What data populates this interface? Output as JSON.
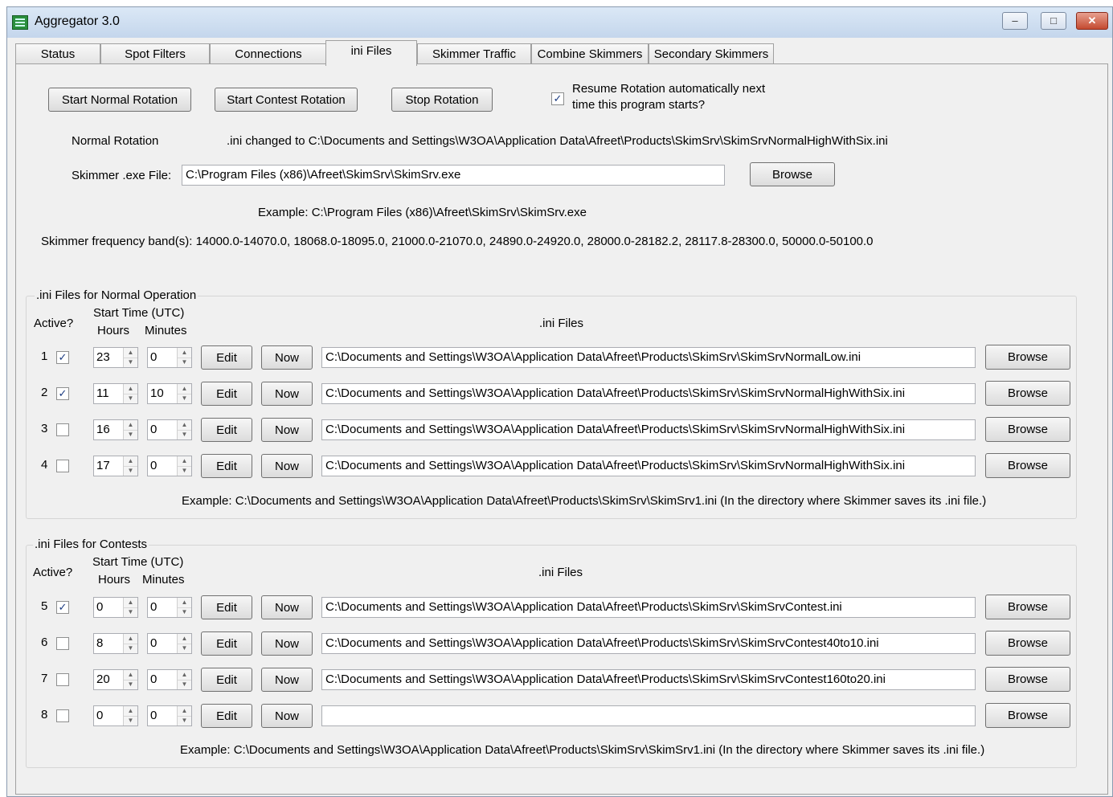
{
  "window": {
    "title": "Aggregator 3.0"
  },
  "tabs": [
    "Status",
    "Spot Filters",
    "Connections",
    "ini Files",
    "Skimmer Traffic",
    "Combine Skimmers",
    "Secondary Skimmers"
  ],
  "controls": {
    "start_normal": "Start Normal Rotation",
    "start_contest": "Start Contest Rotation",
    "stop": "Stop Rotation",
    "resume_line1": "Resume Rotation automatically next",
    "resume_line2": "time this program starts?",
    "resume_checked": true
  },
  "status": {
    "label": "Normal Rotation",
    "message": ".ini changed to C:\\Documents and Settings\\W3OA\\Application Data\\Afreet\\Products\\SkimSrv\\SkimSrvNormalHighWithSix.ini"
  },
  "skimmer": {
    "label": "Skimmer .exe File:",
    "path": "C:\\Program Files (x86)\\Afreet\\SkimSrv\\SkimSrv.exe",
    "browse": "Browse",
    "example": "Example: C:\\Program Files (x86)\\Afreet\\SkimSrv\\SkimSrv.exe",
    "bands": "Skimmer frequency band(s): 14000.0-14070.0, 18068.0-18095.0, 21000.0-21070.0, 24890.0-24920.0, 28000.0-28182.2, 28117.8-28300.0, 50000.0-50100.0"
  },
  "headers": {
    "active": "Active?",
    "start_time": "Start Time (UTC)",
    "hours": "Hours",
    "minutes": "Minutes",
    "ini_files": ".ini Files",
    "edit": "Edit",
    "now": "Now",
    "browse": "Browse"
  },
  "normal": {
    "title": ".ini Files for Normal Operation",
    "example": "Example: C:\\Documents and Settings\\W3OA\\Application Data\\Afreet\\Products\\SkimSrv\\SkimSrv1.ini  (In the directory where Skimmer saves its .ini file.)",
    "rows": [
      {
        "num": "1",
        "active": true,
        "hours": "23",
        "minutes": "0",
        "path": "C:\\Documents and Settings\\W3OA\\Application Data\\Afreet\\Products\\SkimSrv\\SkimSrvNormalLow.ini"
      },
      {
        "num": "2",
        "active": true,
        "hours": "11",
        "minutes": "10",
        "path": "C:\\Documents and Settings\\W3OA\\Application Data\\Afreet\\Products\\SkimSrv\\SkimSrvNormalHighWithSix.ini"
      },
      {
        "num": "3",
        "active": false,
        "hours": "16",
        "minutes": "0",
        "path": "C:\\Documents and Settings\\W3OA\\Application Data\\Afreet\\Products\\SkimSrv\\SkimSrvNormalHighWithSix.ini"
      },
      {
        "num": "4",
        "active": false,
        "hours": "17",
        "minutes": "0",
        "path": "C:\\Documents and Settings\\W3OA\\Application Data\\Afreet\\Products\\SkimSrv\\SkimSrvNormalHighWithSix.ini"
      }
    ]
  },
  "contest": {
    "title": ".ini Files for Contests",
    "example": "Example: C:\\Documents and Settings\\W3OA\\Application Data\\Afreet\\Products\\SkimSrv\\SkimSrv1.ini  (In the directory where Skimmer saves its .ini file.)",
    "rows": [
      {
        "num": "5",
        "active": true,
        "hours": "0",
        "minutes": "0",
        "path": "C:\\Documents and Settings\\W3OA\\Application Data\\Afreet\\Products\\SkimSrv\\SkimSrvContest.ini"
      },
      {
        "num": "6",
        "active": false,
        "hours": "8",
        "minutes": "0",
        "path": "C:\\Documents and Settings\\W3OA\\Application Data\\Afreet\\Products\\SkimSrv\\SkimSrvContest40to10.ini"
      },
      {
        "num": "7",
        "active": false,
        "hours": "20",
        "minutes": "0",
        "path": "C:\\Documents and Settings\\W3OA\\Application Data\\Afreet\\Products\\SkimSrv\\SkimSrvContest160to20.ini"
      },
      {
        "num": "8",
        "active": false,
        "hours": "0",
        "minutes": "0",
        "path": ""
      }
    ]
  }
}
